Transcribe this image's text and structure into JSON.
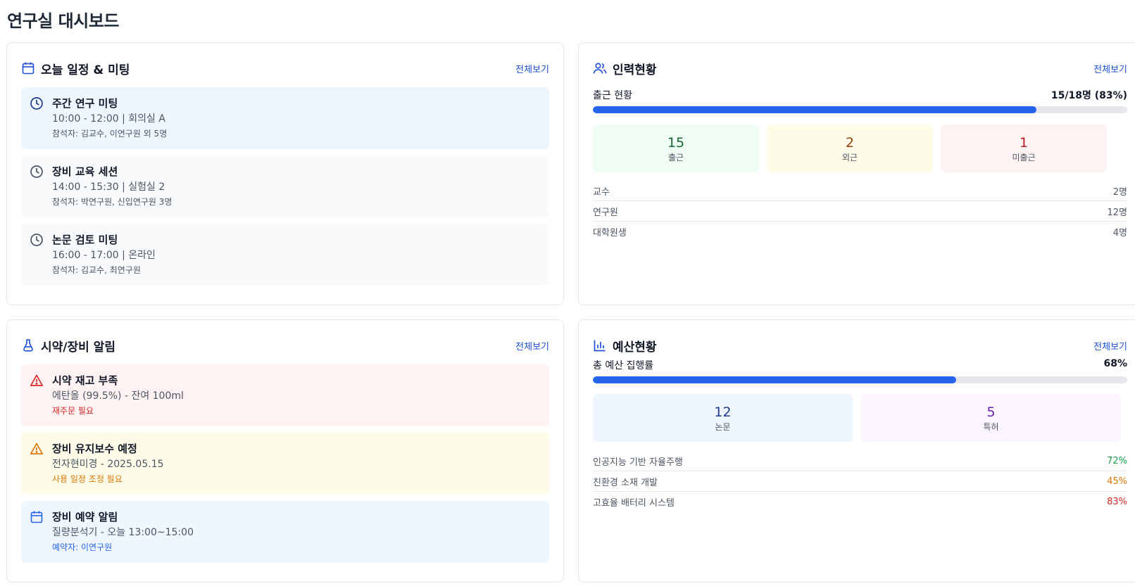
{
  "page": {
    "title": "연구실 대시보드"
  },
  "colors": {
    "accent": "#2563eb",
    "green": "#16a34a",
    "amber": "#d97706",
    "red": "#dc2626"
  },
  "schedule": {
    "title": "오늘 일정 & 미팅",
    "icon": "calendar-icon",
    "view_all": "전체보기",
    "items": [
      {
        "title": "주간 연구 미팅",
        "time": "10:00 - 12:00 | 회의실 A",
        "attendees": "참석자: 김교수, 이연구원 외 5명",
        "icon": "clock-icon"
      },
      {
        "title": "장비 교육 세션",
        "time": "14:00 - 15:30 | 실험실 2",
        "attendees": "참석자: 박연구원, 신입연구원 3명",
        "icon": "clock-icon"
      },
      {
        "title": "논문 검토 미팅",
        "time": "16:00 - 17:00 | 온라인",
        "attendees": "참석자: 김교수, 최연구원",
        "icon": "clock-icon"
      }
    ]
  },
  "staff": {
    "title": "인력현황",
    "icon": "users-icon",
    "view_all": "전체보기",
    "attendance_label": "출근 현황",
    "attendance_value": "15/18명 (83%)",
    "attendance_fraction": 0.83,
    "stats": [
      {
        "num": "15",
        "label": "출근"
      },
      {
        "num": "2",
        "label": "외근"
      },
      {
        "num": "1",
        "label": "미출근"
      }
    ],
    "breakdown": [
      {
        "label": "교수",
        "value": "2명"
      },
      {
        "label": "연구원",
        "value": "12명"
      },
      {
        "label": "대학원생",
        "value": "4명"
      }
    ]
  },
  "alerts": {
    "title": "시약/장비 알림",
    "icon": "flask-icon",
    "view_all": "전체보기",
    "items": [
      {
        "title": "시약 재고 부족",
        "detail": "에탄올 (99.5%) - 잔여 100ml",
        "note": "재주문 필요",
        "icon": "warning-icon"
      },
      {
        "title": "장비 유지보수 예정",
        "detail": "전자현미경 - 2025.05.15",
        "note": "사용 일정 조정 필요",
        "icon": "warning-icon"
      },
      {
        "title": "장비 예약 알림",
        "detail": "질량분석기 - 오늘 13:00~15:00",
        "note": "예약자: 이연구원",
        "icon": "calendar-icon"
      }
    ]
  },
  "budget": {
    "title": "예산현황",
    "icon": "bar-chart-icon",
    "view_all": "전체보기",
    "execution_label": "총 예산 집행률",
    "execution_value": "68%",
    "execution_fraction": 0.68,
    "stats": [
      {
        "num": "12",
        "label": "논문"
      },
      {
        "num": "5",
        "label": "특허"
      }
    ],
    "projects": [
      {
        "label": "인공지능 기반 자율주행",
        "value": "72%"
      },
      {
        "label": "친환경 소재 개발",
        "value": "45%"
      },
      {
        "label": "고효율 배터리 시스템",
        "value": "83%"
      }
    ]
  }
}
